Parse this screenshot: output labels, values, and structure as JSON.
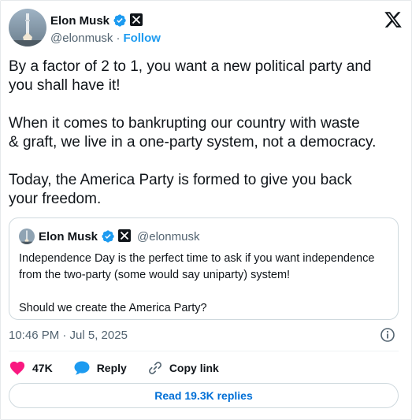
{
  "author": {
    "display_name": "Elon Musk",
    "handle": "@elonmusk",
    "separator": "·",
    "follow_label": "Follow"
  },
  "tweet": {
    "text": "By a factor of 2 to 1, you want a new political party and\nyou shall have it!\n\nWhen it comes to bankrupting our country with waste\n& graft, we live in a one-party system, not a democracy.\n\nToday, the America Party is formed to give you back\nyour freedom.",
    "timestamp": "10:46 PM · Jul 5, 2025"
  },
  "quoted_tweet": {
    "display_name": "Elon Musk",
    "handle": "@elonmusk",
    "text": "Independence Day is the perfect time to ask if you want independence\nfrom the two-party (some would say uniparty) system!\n\nShould we create the America Party?"
  },
  "actions": {
    "like_count": "47K",
    "reply_label": "Reply",
    "copy_link_label": "Copy link"
  },
  "footer": {
    "read_replies_label": "Read 19.3K replies"
  },
  "icons": {
    "verified": "verified-badge-icon",
    "affiliate": "x-affiliate-icon",
    "brand": "x-logo-icon",
    "info": "info-icon",
    "like": "heart-icon",
    "reply": "speech-bubble-icon",
    "copy_link": "link-icon"
  },
  "colors": {
    "accent": "#1d9bf0",
    "like": "#f91880",
    "reply_button_text": "#006fd6",
    "muted_text": "#536471"
  }
}
